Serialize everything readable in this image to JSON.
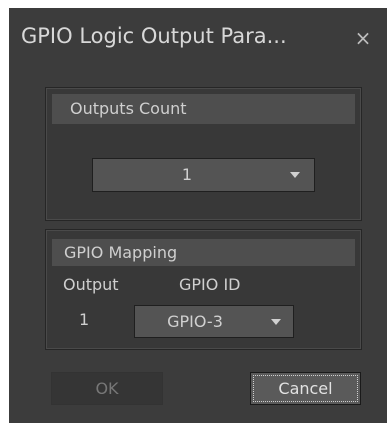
{
  "window": {
    "title": "GPIO Logic Output Para...",
    "close_symbol": "×"
  },
  "outputs_count": {
    "header": "Outputs Count",
    "selected_value": "1"
  },
  "gpio_mapping": {
    "header": "GPIO Mapping",
    "columns": [
      "Output",
      "GPIO ID"
    ],
    "rows": [
      {
        "output": "1",
        "gpio_id": "GPIO-3"
      }
    ]
  },
  "buttons": {
    "ok_label": "OK",
    "ok_enabled": false,
    "cancel_label": "Cancel"
  },
  "icons": {
    "close": "close-icon",
    "dropdown": "chevron-down-icon"
  },
  "colors": {
    "dialog_background": "#3c3c3c",
    "group_header": "#4e4e4e",
    "combo_background": "#545454",
    "text": "#cfcfcf"
  }
}
